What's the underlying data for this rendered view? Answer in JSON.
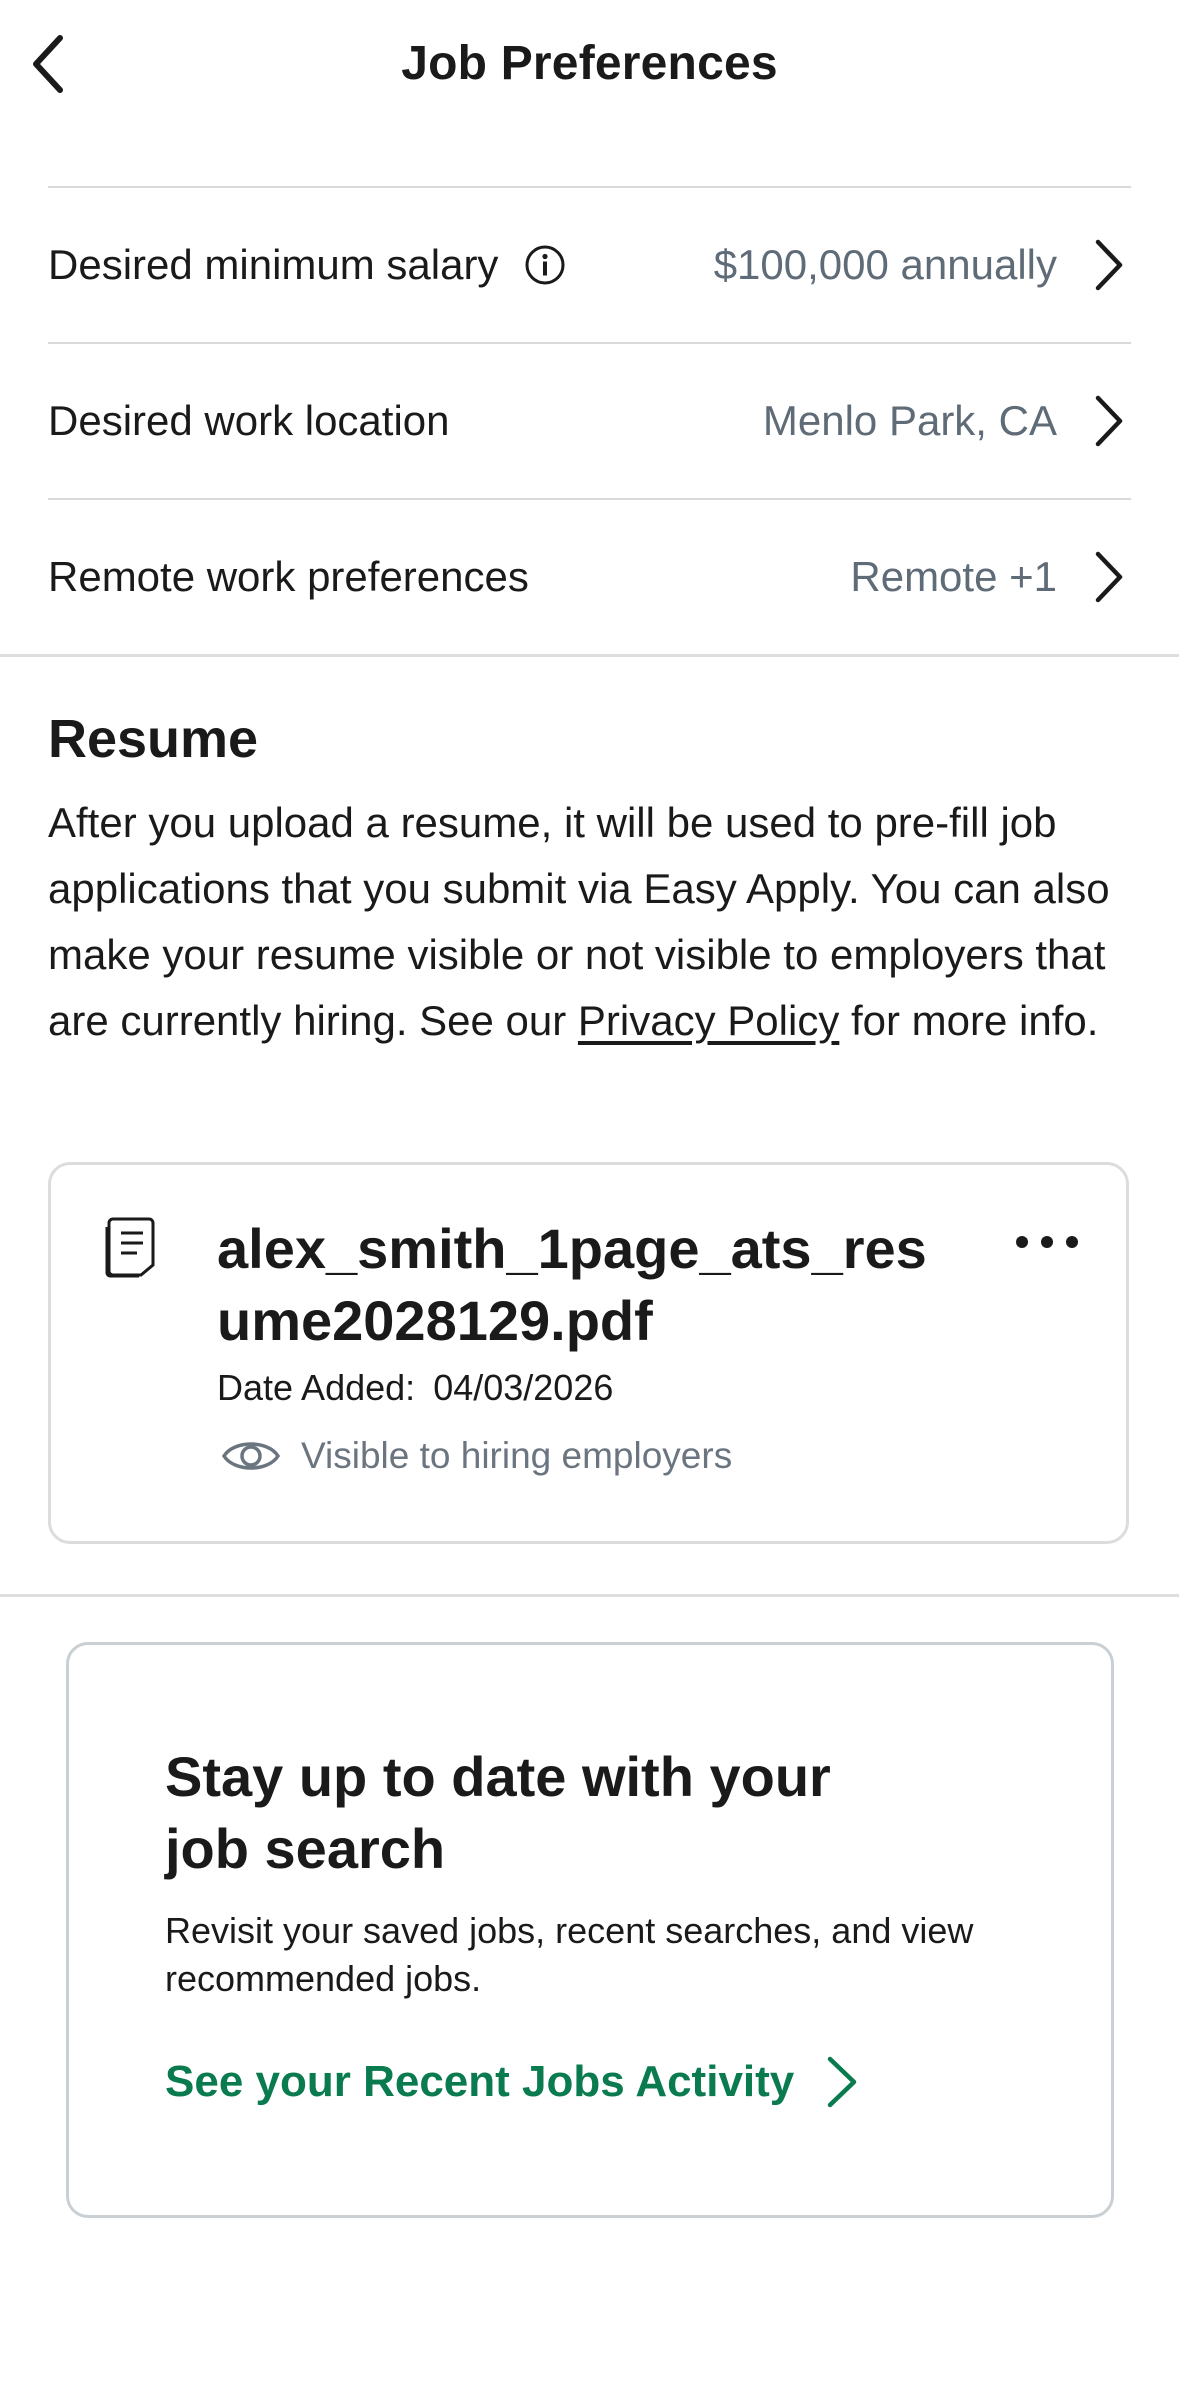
{
  "header": {
    "title": "Job Preferences"
  },
  "preferences": [
    {
      "label": "Desired minimum salary",
      "value": "$100,000 annually",
      "has_info": true
    },
    {
      "label": "Desired work location",
      "value": "Menlo Park, CA",
      "has_info": false
    },
    {
      "label": "Remote work preferences",
      "value": "Remote +1",
      "has_info": false
    }
  ],
  "resume": {
    "title": "Resume",
    "description_pre": "After you upload a resume, it will be used to pre-fill job applications that you submit via Easy Apply. You can also make your resume visible or not visible to employers that are currently hiring. See our ",
    "privacy_link": "Privacy Policy",
    "description_post": " for more info.",
    "file": {
      "name": "alex_smith_1page_ats_resume2028129.pdf",
      "date_label": "Date Added:",
      "date": "04/03/2026",
      "visibility": "Visible to hiring employers"
    }
  },
  "promo": {
    "title": "Stay up to date with your job search",
    "description": "Revisit your saved jobs, recent searches, and view recommended jobs.",
    "link": "See your Recent Jobs Activity"
  },
  "colors": {
    "link_green": "#0a7a4f",
    "value_gray": "#5f6b77",
    "divider": "#d9d9d9"
  },
  "icons": [
    "back-arrow-icon",
    "info-icon",
    "chevron-right-icon",
    "document-icon",
    "more-icon",
    "eye-icon"
  ]
}
